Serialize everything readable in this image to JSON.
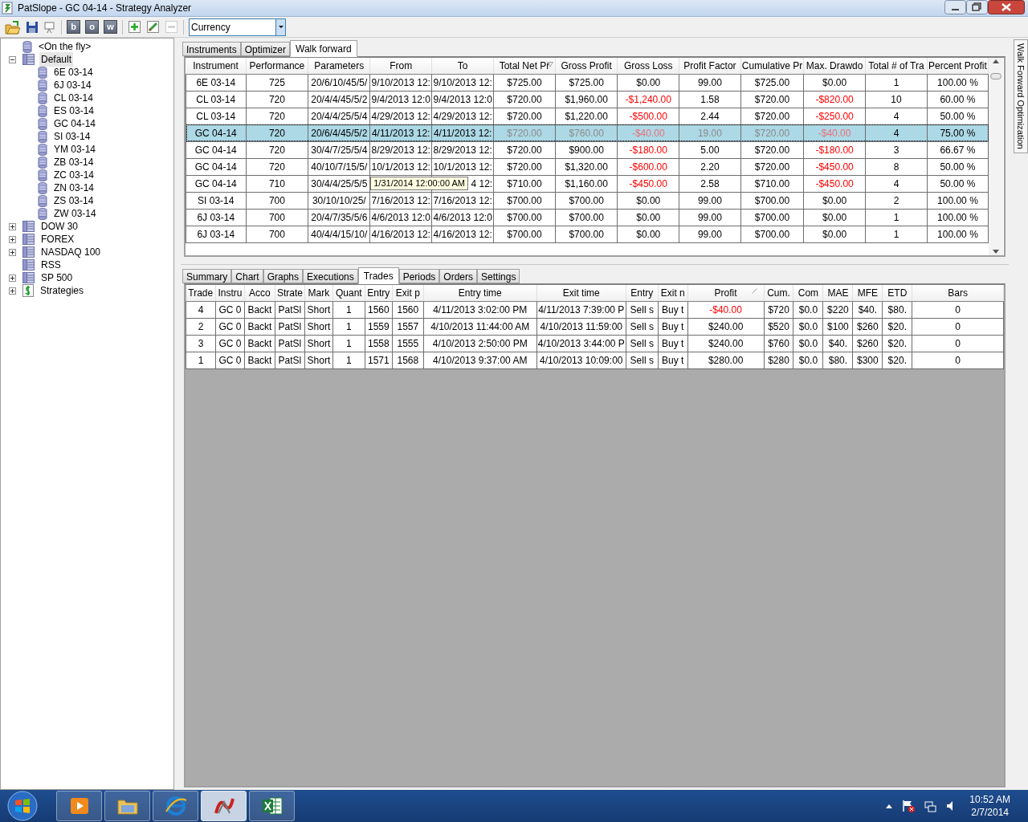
{
  "window": {
    "title": "PatSlope - GC 04-14 - Strategy Analyzer"
  },
  "toolbar": {
    "letter_buttons": [
      "b",
      "o",
      "w"
    ],
    "remove_disabled": true,
    "combo": {
      "value": "Currency"
    }
  },
  "tree": [
    {
      "label": "<On the fly>",
      "kind": "instrument",
      "expanded": false,
      "selected": false
    },
    {
      "label": "Default",
      "kind": "list",
      "expanded": true,
      "selected": true,
      "children": [
        {
          "label": "6E 03-14",
          "kind": "instrument"
        },
        {
          "label": "6J 03-14",
          "kind": "instrument"
        },
        {
          "label": "CL 03-14",
          "kind": "instrument"
        },
        {
          "label": "ES 03-14",
          "kind": "instrument"
        },
        {
          "label": "GC 04-14",
          "kind": "instrument"
        },
        {
          "label": "SI 03-14",
          "kind": "instrument"
        },
        {
          "label": "YM 03-14",
          "kind": "instrument"
        },
        {
          "label": "ZB 03-14",
          "kind": "instrument"
        },
        {
          "label": "ZC 03-14",
          "kind": "instrument"
        },
        {
          "label": "ZN 03-14",
          "kind": "instrument"
        },
        {
          "label": "ZS 03-14",
          "kind": "instrument"
        },
        {
          "label": "ZW 03-14",
          "kind": "instrument"
        }
      ]
    },
    {
      "label": "DOW 30",
      "kind": "list",
      "expanded": false,
      "selected": false,
      "expandable": true
    },
    {
      "label": "FOREX",
      "kind": "list",
      "expanded": false,
      "selected": false,
      "expandable": true
    },
    {
      "label": "NASDAQ 100",
      "kind": "list",
      "expanded": false,
      "selected": false,
      "expandable": true
    },
    {
      "label": "RSS",
      "kind": "list",
      "expanded": false,
      "selected": false,
      "expandable": false
    },
    {
      "label": "SP 500",
      "kind": "list",
      "expanded": false,
      "selected": false,
      "expandable": true
    },
    {
      "label": "Strategies",
      "kind": "strategy",
      "expanded": false,
      "selected": false,
      "expandable": true
    }
  ],
  "side_tab": {
    "label": "Walk Forward Optimization"
  },
  "upper_tabs": [
    {
      "label": "Instruments",
      "selected": false
    },
    {
      "label": "Optimizer",
      "selected": false
    },
    {
      "label": "Walk forward",
      "selected": true
    }
  ],
  "results_table": {
    "columns": [
      {
        "label": "Instrument"
      },
      {
        "label": "Performance"
      },
      {
        "label": "Parameters"
      },
      {
        "label": "From"
      },
      {
        "label": "To"
      },
      {
        "label": "Total Net Pr",
        "sorted": true,
        "descending": true
      },
      {
        "label": "Gross Profit"
      },
      {
        "label": "Gross Loss"
      },
      {
        "label": "Profit Factor"
      },
      {
        "label": "Cumulative Pr"
      },
      {
        "label": "Max. Drawdo"
      },
      {
        "label": "Total # of Tra"
      },
      {
        "label": "Percent Profit"
      }
    ],
    "rows": [
      {
        "selected": false,
        "cells": [
          {
            "text": "6E 03-14"
          },
          {
            "text": "725"
          },
          {
            "text": "20/6/10/45/5/"
          },
          {
            "text": "9/10/2013 12:"
          },
          {
            "text": "9/10/2013 12:"
          },
          {
            "text": "$725.00"
          },
          {
            "text": "$725.00"
          },
          {
            "text": "$0.00"
          },
          {
            "text": "99.00"
          },
          {
            "text": "$725.00"
          },
          {
            "text": "$0.00"
          },
          {
            "text": "1"
          },
          {
            "text": "100.00 %"
          }
        ]
      },
      {
        "selected": false,
        "cells": [
          {
            "text": "CL 03-14"
          },
          {
            "text": "720"
          },
          {
            "text": "20/4/4/45/5/2"
          },
          {
            "text": "9/4/2013 12:0"
          },
          {
            "text": "9/4/2013 12:0"
          },
          {
            "text": "$720.00"
          },
          {
            "text": "$1,960.00"
          },
          {
            "text": "-$1,240.00",
            "loss": true
          },
          {
            "text": "1.58"
          },
          {
            "text": "$720.00"
          },
          {
            "text": "-$820.00",
            "loss": true
          },
          {
            "text": "10"
          },
          {
            "text": "60.00 %"
          }
        ]
      },
      {
        "selected": false,
        "cells": [
          {
            "text": "CL 03-14"
          },
          {
            "text": "720"
          },
          {
            "text": "20/4/4/25/5/4"
          },
          {
            "text": "4/29/2013 12:"
          },
          {
            "text": "4/29/2013 12:"
          },
          {
            "text": "$720.00"
          },
          {
            "text": "$1,220.00"
          },
          {
            "text": "-$500.00",
            "loss": true
          },
          {
            "text": "2.44"
          },
          {
            "text": "$720.00"
          },
          {
            "text": "-$250.00",
            "loss": true
          },
          {
            "text": "4"
          },
          {
            "text": "50.00 %"
          }
        ]
      },
      {
        "selected": true,
        "cells": [
          {
            "text": "GC 04-14"
          },
          {
            "text": "720"
          },
          {
            "text": "20/6/4/45/5/2"
          },
          {
            "text": "4/11/2013 12:"
          },
          {
            "text": "4/11/2013 12:"
          },
          {
            "text": "$720.00",
            "dimmed": true
          },
          {
            "text": "$760.00",
            "dimmed": true
          },
          {
            "text": "-$40.00",
            "loss": true,
            "dimmed": true
          },
          {
            "text": "19.00",
            "dimmed": true
          },
          {
            "text": "$720.00",
            "dimmed": true
          },
          {
            "text": "-$40.00",
            "loss": true,
            "dimmed": true
          },
          {
            "text": "4"
          },
          {
            "text": "75.00 %"
          }
        ]
      },
      {
        "selected": false,
        "cells": [
          {
            "text": "GC 04-14"
          },
          {
            "text": "720"
          },
          {
            "text": "30/4/7/25/5/4"
          },
          {
            "text": "8/29/2013 12:"
          },
          {
            "text": "8/29/2013 12:"
          },
          {
            "text": "$720.00"
          },
          {
            "text": "$900.00"
          },
          {
            "text": "-$180.00",
            "loss": true
          },
          {
            "text": "5.00"
          },
          {
            "text": "$720.00"
          },
          {
            "text": "-$180.00",
            "loss": true
          },
          {
            "text": "3"
          },
          {
            "text": "66.67 %"
          }
        ]
      },
      {
        "selected": false,
        "cells": [
          {
            "text": "GC 04-14"
          },
          {
            "text": "720"
          },
          {
            "text": "40/10/7/15/5/"
          },
          {
            "text": "10/1/2013 12:"
          },
          {
            "text": "10/1/2013 12:"
          },
          {
            "text": "$720.00"
          },
          {
            "text": "$1,320.00"
          },
          {
            "text": "-$600.00",
            "loss": true
          },
          {
            "text": "2.20"
          },
          {
            "text": "$720.00"
          },
          {
            "text": "-$450.00",
            "loss": true
          },
          {
            "text": "8"
          },
          {
            "text": "50.00 %"
          }
        ]
      },
      {
        "selected": false,
        "tooltip": {
          "text": "1/31/2014 12:00:00 AM"
        },
        "cells": [
          {
            "text": "GC 04-14"
          },
          {
            "text": "710"
          },
          {
            "text": "30/4/4/25/5/5"
          },
          {},
          {
            "text": "4 12:"
          },
          {
            "text": "$710.00"
          },
          {
            "text": "$1,160.00"
          },
          {
            "text": "-$450.00",
            "loss": true
          },
          {
            "text": "2.58"
          },
          {
            "text": "$710.00"
          },
          {
            "text": "-$450.00",
            "loss": true
          },
          {
            "text": "4"
          },
          {
            "text": "50.00 %"
          }
        ]
      },
      {
        "selected": false,
        "cells": [
          {
            "text": "SI 03-14"
          },
          {
            "text": "700"
          },
          {
            "text": "30/10/10/25/"
          },
          {
            "text": "7/16/2013 12:"
          },
          {
            "text": "7/16/2013 12:"
          },
          {
            "text": "$700.00"
          },
          {
            "text": "$700.00"
          },
          {
            "text": "$0.00"
          },
          {
            "text": "99.00"
          },
          {
            "text": "$700.00"
          },
          {
            "text": "$0.00"
          },
          {
            "text": "2"
          },
          {
            "text": "100.00 %"
          }
        ]
      },
      {
        "selected": false,
        "cells": [
          {
            "text": "6J 03-14"
          },
          {
            "text": "700"
          },
          {
            "text": "20/4/7/35/5/6"
          },
          {
            "text": "4/6/2013 12:0"
          },
          {
            "text": "4/6/2013 12:0"
          },
          {
            "text": "$700.00"
          },
          {
            "text": "$700.00"
          },
          {
            "text": "$0.00"
          },
          {
            "text": "99.00"
          },
          {
            "text": "$700.00"
          },
          {
            "text": "$0.00"
          },
          {
            "text": "1"
          },
          {
            "text": "100.00 %"
          }
        ]
      },
      {
        "selected": false,
        "cells": [
          {
            "text": "6J 03-14"
          },
          {
            "text": "700"
          },
          {
            "text": "40/4/4/15/10/"
          },
          {
            "text": "4/16/2013 12:"
          },
          {
            "text": "4/16/2013 12:"
          },
          {
            "text": "$700.00"
          },
          {
            "text": "$700.00"
          },
          {
            "text": "$0.00"
          },
          {
            "text": "99.00"
          },
          {
            "text": "$700.00"
          },
          {
            "text": "$0.00"
          },
          {
            "text": "1"
          },
          {
            "text": "100.00 %"
          }
        ]
      }
    ]
  },
  "lower_tabs": [
    {
      "label": "Summary",
      "selected": false
    },
    {
      "label": "Chart",
      "selected": false
    },
    {
      "label": "Graphs",
      "selected": false
    },
    {
      "label": "Executions",
      "selected": false
    },
    {
      "label": "Trades",
      "selected": true
    },
    {
      "label": "Periods",
      "selected": false
    },
    {
      "label": "Orders",
      "selected": false
    },
    {
      "label": "Settings",
      "selected": false
    }
  ],
  "trades_table": {
    "columns": [
      {
        "label": "Trade"
      },
      {
        "label": "Instru"
      },
      {
        "label": "Acco"
      },
      {
        "label": "Strate"
      },
      {
        "label": "Mark"
      },
      {
        "label": "Quant"
      },
      {
        "label": "Entry"
      },
      {
        "label": "Exit p"
      },
      {
        "label": "Entry time"
      },
      {
        "label": "Exit time"
      },
      {
        "label": "Entry"
      },
      {
        "label": "Exit n"
      },
      {
        "label": "Profit",
        "sorted": true,
        "descending": false
      },
      {
        "label": "Cum."
      },
      {
        "label": "Com"
      },
      {
        "label": "MAE"
      },
      {
        "label": "MFE"
      },
      {
        "label": "ETD"
      },
      {
        "label": "Bars"
      }
    ],
    "rows": [
      {
        "cells": [
          {
            "text": "4"
          },
          {
            "text": "GC 0"
          },
          {
            "text": "Backt"
          },
          {
            "text": "PatSl"
          },
          {
            "text": "Short"
          },
          {
            "text": "1"
          },
          {
            "text": "1560"
          },
          {
            "text": "1560"
          },
          {
            "text": "4/11/2013 3:02:00 PM"
          },
          {
            "text": "4/11/2013 7:39:00 P"
          },
          {
            "text": "Sell s"
          },
          {
            "text": "Buy t"
          },
          {
            "text": "-$40.00",
            "loss": true
          },
          {
            "text": "$720"
          },
          {
            "text": "$0.0"
          },
          {
            "text": "$220"
          },
          {
            "text": "$40."
          },
          {
            "text": "$80."
          },
          {
            "text": "0"
          }
        ]
      },
      {
        "cells": [
          {
            "text": "2"
          },
          {
            "text": "GC 0"
          },
          {
            "text": "Backt"
          },
          {
            "text": "PatSl"
          },
          {
            "text": "Short"
          },
          {
            "text": "1"
          },
          {
            "text": "1559"
          },
          {
            "text": "1557"
          },
          {
            "text": "4/10/2013 11:44:00 AM"
          },
          {
            "text": "4/10/2013 11:59:00"
          },
          {
            "text": "Sell s"
          },
          {
            "text": "Buy t"
          },
          {
            "text": "$240.00"
          },
          {
            "text": "$520"
          },
          {
            "text": "$0.0"
          },
          {
            "text": "$100"
          },
          {
            "text": "$260"
          },
          {
            "text": "$20."
          },
          {
            "text": "0"
          }
        ]
      },
      {
        "cells": [
          {
            "text": "3"
          },
          {
            "text": "GC 0"
          },
          {
            "text": "Backt"
          },
          {
            "text": "PatSl"
          },
          {
            "text": "Short"
          },
          {
            "text": "1"
          },
          {
            "text": "1558"
          },
          {
            "text": "1555"
          },
          {
            "text": "4/10/2013 2:50:00 PM"
          },
          {
            "text": "4/10/2013 3:44:00 P"
          },
          {
            "text": "Sell s"
          },
          {
            "text": "Buy t"
          },
          {
            "text": "$240.00"
          },
          {
            "text": "$760"
          },
          {
            "text": "$0.0"
          },
          {
            "text": "$40."
          },
          {
            "text": "$260"
          },
          {
            "text": "$20."
          },
          {
            "text": "0"
          }
        ]
      },
      {
        "cells": [
          {
            "text": "1"
          },
          {
            "text": "GC 0"
          },
          {
            "text": "Backt"
          },
          {
            "text": "PatSl"
          },
          {
            "text": "Short"
          },
          {
            "text": "1"
          },
          {
            "text": "1571"
          },
          {
            "text": "1568"
          },
          {
            "text": "4/10/2013 9:37:00 AM"
          },
          {
            "text": "4/10/2013 10:09:00"
          },
          {
            "text": "Sell s"
          },
          {
            "text": "Buy t"
          },
          {
            "text": "$280.00"
          },
          {
            "text": "$280"
          },
          {
            "text": "$0.0"
          },
          {
            "text": "$80."
          },
          {
            "text": "$300"
          },
          {
            "text": "$20."
          },
          {
            "text": "0"
          }
        ]
      }
    ]
  },
  "taskbar": {
    "apps": [
      {
        "kind": "media",
        "selected": false
      },
      {
        "kind": "folder",
        "selected": false
      },
      {
        "kind": "browser",
        "selected": false
      },
      {
        "kind": "trading",
        "selected": true
      },
      {
        "kind": "spreadsheet",
        "selected": false
      }
    ],
    "tray": {
      "time": "10:52 AM",
      "date": "2/7/2014"
    }
  }
}
